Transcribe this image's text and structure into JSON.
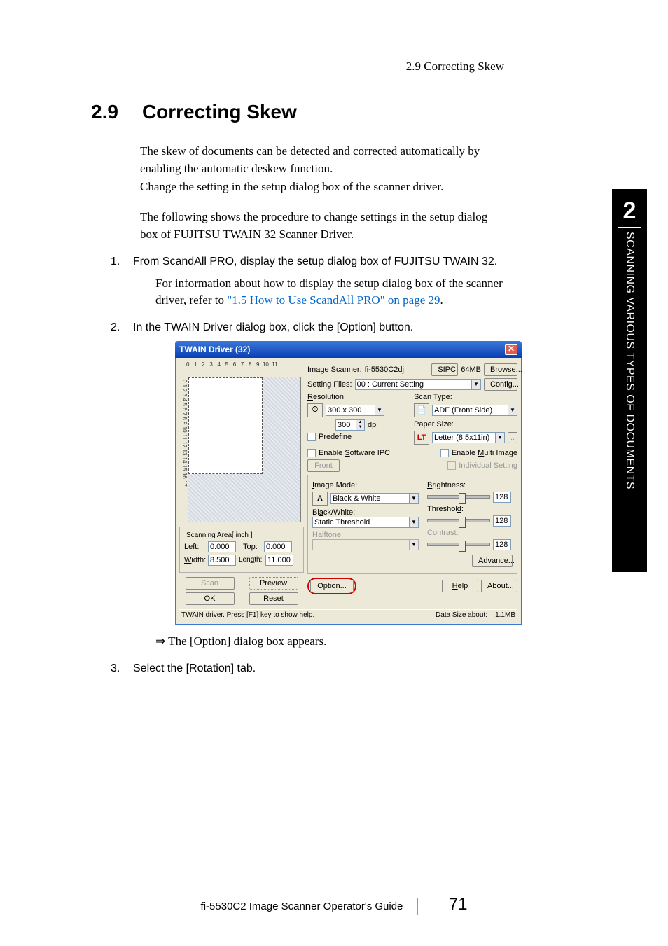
{
  "header": {
    "breadcrumb": "2.9 Correcting Skew"
  },
  "section": {
    "number": "2.9",
    "title": "Correcting Skew"
  },
  "paragraphs": {
    "p1": "The skew of documents can be detected and corrected automatically by enabling the automatic deskew function.",
    "p2": "Change the setting in the setup dialog box of the scanner driver.",
    "p3": "The following shows the procedure to change settings in the setup dialog box of FUJITSU TWAIN 32 Scanner Driver."
  },
  "steps": {
    "s1": {
      "num": "1.",
      "text": "From ScandAll PRO, display the setup dialog box of FUJITSU TWAIN 32."
    },
    "s1_detail_a": "For information about how to display the setup dialog box of the scanner driver, refer to ",
    "s1_link": "\"1.5 How to Use ScandAll PRO\" on page 29",
    "s1_detail_b": ".",
    "s2": {
      "num": "2.",
      "text": "In the TWAIN Driver dialog box, click the [Option] button."
    },
    "result": "⇒ The [Option] dialog box appears.",
    "s3": {
      "num": "3.",
      "text": "Select the [Rotation] tab."
    }
  },
  "sidetab": {
    "chapter": "2",
    "title": "SCANNING VARIOUS TYPES OF DOCUMENTS"
  },
  "footer": {
    "guide": "fi-5530C2 Image Scanner Operator's Guide",
    "page": "71"
  },
  "dialog": {
    "title": "TWAIN Driver (32)",
    "ruler_h": "0   1   2   3   4   5   6   7   8   9  10  11",
    "ruler_v": "0 1 2 3 4 5 6 7 8 9 10 11 12 13 14 15 16 17",
    "scanning_area_label": "Scanning Area[ inch ]",
    "left_label": "Left:",
    "left_val": "0.000",
    "top_label": "Top:",
    "top_val": "0.000",
    "width_label": "Width:",
    "width_val": "8.500",
    "length_label": "Length:",
    "length_val": "11.000",
    "scan_btn": "Scan",
    "preview_btn": "Preview",
    "ok_btn": "OK",
    "reset_btn": "Reset",
    "scanner_label": "Image Scanner:",
    "scanner_val": "fi-5530C2dj",
    "sipc_btn": "SIPC",
    "mem": "64MB",
    "browse_btn": "Browse...",
    "setting_files_label": "Setting Files:",
    "setting_files_val": "00 : Current Setting",
    "config_btn": "Config...",
    "resolution_label": "Resolution",
    "resolution_val": "300 x 300",
    "dpi_val": "300",
    "dpi_label": "dpi",
    "predefine_label": "Predefine",
    "scan_type_label": "Scan Type:",
    "scan_type_val": "ADF (Front Side)",
    "paper_size_label": "Paper Size:",
    "paper_size_val": "Letter (8.5x11in)",
    "enable_ipc_label": "Enable Software IPC",
    "enable_multi_label": "Enable Multi Image",
    "front_label": "Front",
    "individual_label": "Individual Setting",
    "image_mode_label": "Image Mode:",
    "image_mode_val": "Black & White",
    "bw_label": "Black/White:",
    "bw_val": "Static Threshold",
    "halftone_label": "Halftone:",
    "brightness_label": "Brightness:",
    "brightness_val": "128",
    "threshold_label": "Threshold:",
    "threshold_val": "128",
    "contrast_label": "Contrast:",
    "contrast_val": "128",
    "advance_btn": "Advance...",
    "option_btn": "Option...",
    "help_btn": "Help",
    "about_btn": "About...",
    "status_left": "TWAIN driver. Press [F1] key to show help.",
    "status_right_label": "Data Size about:",
    "status_right_val": "1.1MB"
  }
}
